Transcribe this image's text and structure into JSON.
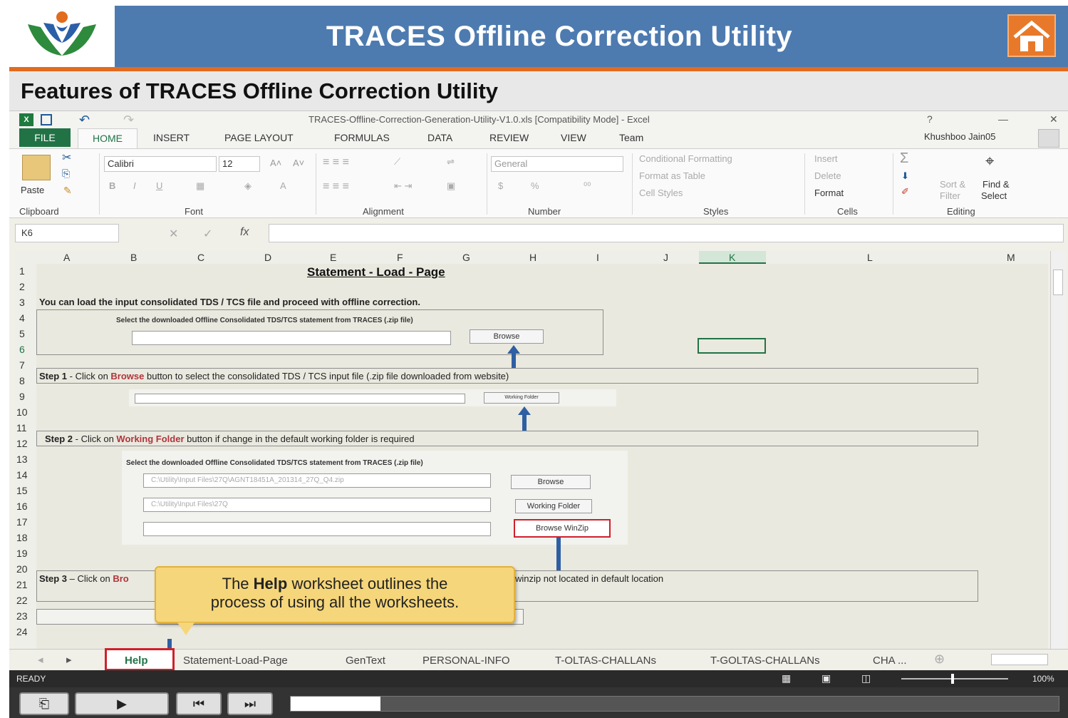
{
  "banner": {
    "title": "TRACES Offline Correction Utility"
  },
  "subtitle": "Features of TRACES Offline Correction Utility",
  "excel": {
    "window_title": "TRACES-Offline-Correction-Generation-Utility-V1.0.xls  [Compatibility Mode] - Excel",
    "title_controls": {
      "help": "?",
      "minimize": "—",
      "close": "✕"
    },
    "tabs": [
      "FILE",
      "HOME",
      "INSERT",
      "PAGE LAYOUT",
      "FORMULAS",
      "DATA",
      "REVIEW",
      "VIEW",
      "Team"
    ],
    "user": "Khushboo Jain05",
    "ribbon": {
      "paste": "Paste",
      "font_name": "Calibri",
      "font_size": "12",
      "number_format": "General",
      "currency": "$",
      "percent": "%",
      "conditional_formatting": "Conditional Formatting",
      "format_as_table": "Format as Table",
      "cell_styles": "Cell Styles",
      "insert": "Insert",
      "delete": "Delete",
      "format": "Format",
      "sort_filter_1": "Sort &",
      "sort_filter_2": "Filter",
      "find_select_1": "Find &",
      "find_select_2": "Select",
      "groups": [
        "Clipboard",
        "Font",
        "Alignment",
        "Number",
        "Styles",
        "Cells",
        "Editing"
      ]
    },
    "name_box": "K6",
    "fx": "fx",
    "columns": [
      "A",
      "B",
      "C",
      "D",
      "E",
      "F",
      "G",
      "H",
      "I",
      "J",
      "K",
      "L",
      "M"
    ],
    "rows": [
      "1",
      "2",
      "3",
      "4",
      "5",
      "6",
      "7",
      "8",
      "9",
      "10",
      "11",
      "12",
      "13",
      "14",
      "15",
      "16",
      "17",
      "18",
      "19",
      "20",
      "21",
      "22",
      "23",
      "24"
    ],
    "sheet": {
      "heading": "Statement - Load - Page",
      "intro": "You can load the input consolidated TDS / TCS file and proceed with offline correction.",
      "select_label": "Select the downloaded Offline Consolidated TDS/TCS statement from TRACES (.zip file)",
      "browse": "Browse",
      "working_folder": "Working Folder",
      "browse_winzip": "Browse WinZip",
      "step1_prefix": "Step 1",
      "step1_a": " - Click on ",
      "step1_hl": "Browse",
      "step1_b": " button to select the consolidated TDS / TCS input file (.zip file downloaded from website)",
      "step2_prefix": "Step 2",
      "step2_a": " - Click on ",
      "step2_hl": "Working Folder",
      "step2_b": " button if change in the default working folder is required",
      "step3_prefix": "Step 3",
      "step3_a": " – Click on ",
      "step3_hl": "Bro",
      "step3_tail": "winzip not located in default location",
      "select_label2": "Select the downloaded Offline Consolidated TDS/TCS statement from TRACES (.zip file)",
      "path1": "C:\\Utility\\Input Files\\27Q\\AGNT18451A_201314_27Q_Q4.zip",
      "path2": "C:\\Utility\\Input Files\\27Q"
    },
    "callout": {
      "line1_a": "The ",
      "line1_b": "Help",
      "line1_c": " worksheet outlines the",
      "line2": "process of using all the worksheets."
    },
    "sheet_tabs": [
      "Help",
      "Statement-Load-Page",
      "GenText",
      "PERSONAL-INFO",
      "T-OLTAS-CHALLANs",
      "T-GOLTAS-CHALLANs",
      "CHA ..."
    ],
    "status": {
      "mode": "READY",
      "zoom": "100%"
    }
  },
  "colors": {
    "banner": "#4d7bb0",
    "accent": "#e26b1e",
    "highlight": "#b0343b",
    "callout": "#f6d67a",
    "arrow": "#2f5fa3"
  }
}
